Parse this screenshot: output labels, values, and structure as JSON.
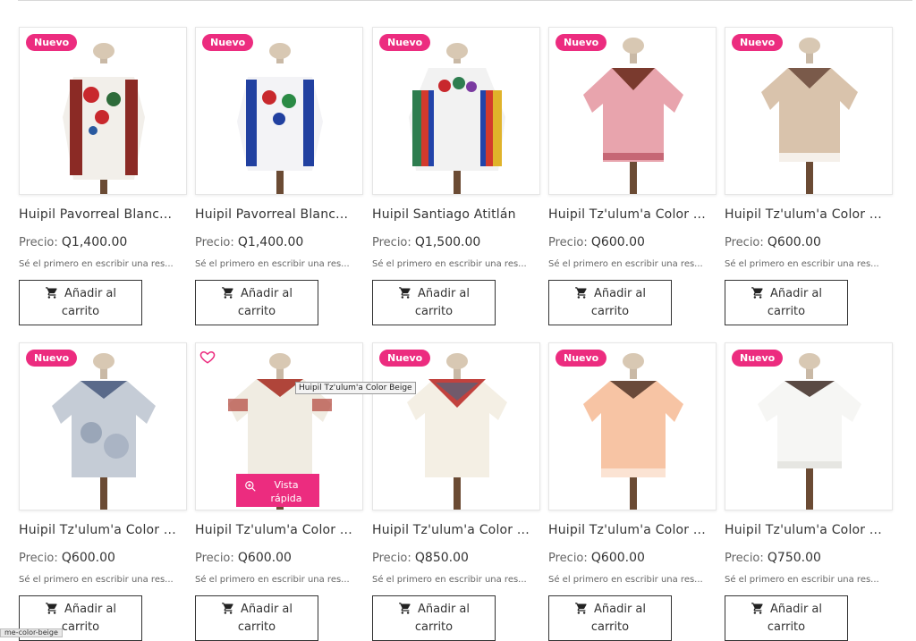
{
  "colors": {
    "accent": "#ec2c7f",
    "text": "#333333",
    "muted": "#666666"
  },
  "price_prefix": "Precio:",
  "review_text": "Sé el primero en escribir una res...",
  "cart_label_line1": "Añadir al",
  "cart_label_line2": "carrito",
  "badge_label": "Nuevo",
  "tooltip": "Huipil Tz'ulum'a Color Beige",
  "quickview": {
    "line1": "Vista",
    "line2": "rápida"
  },
  "status_text": "me-color-beige",
  "products": [
    {
      "title": "Huipil Pavorreal Blanc...",
      "price": "Q1,400.00"
    },
    {
      "title": "Huipil Pavorreal Blanc...",
      "price": "Q1,400.00"
    },
    {
      "title": "Huipil Santiago Atitlán",
      "price": "Q1,500.00"
    },
    {
      "title": "Huipil Tz'ulum'a Color ...",
      "price": "Q600.00"
    },
    {
      "title": "Huipil Tz'ulum'a Color ...",
      "price": "Q600.00"
    },
    {
      "title": "Huipil Tz'ulum'a Color ...",
      "price": "Q600.00"
    },
    {
      "title": "Huipil Tz'ulum'a Color ...",
      "price": "Q600.00"
    },
    {
      "title": "Huipil Tz'ulum'a Color ...",
      "price": "Q850.00"
    },
    {
      "title": "Huipil Tz'ulum'a Color ...",
      "price": "Q600.00"
    },
    {
      "title": "Huipil Tz'ulum'a Color ...",
      "price": "Q750.00"
    }
  ]
}
